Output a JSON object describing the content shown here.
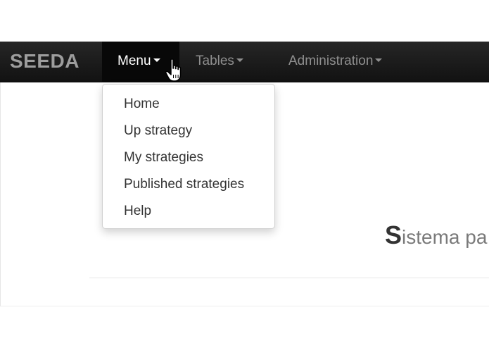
{
  "navbar": {
    "brand": "SEEDA",
    "items": [
      {
        "label": "Menu",
        "active": true
      },
      {
        "label": "Tables",
        "active": false
      },
      {
        "label": "Administration",
        "active": false
      }
    ]
  },
  "dropdown": {
    "items": [
      {
        "label": "Home"
      },
      {
        "label": "Up strategy"
      },
      {
        "label": "My strategies"
      },
      {
        "label": "Published strategies"
      },
      {
        "label": "Help"
      }
    ]
  },
  "main": {
    "headline_first_letter": "S",
    "headline_rest": "istema pa"
  },
  "icons": {
    "caret": "caret-down-icon",
    "cursor": "hand-pointer-icon"
  },
  "colors": {
    "navbar_bg": "#1b1b1b",
    "active_tab_bg": "#080808",
    "nav_text": "#8f8f8f",
    "active_text": "#ffffff",
    "dropdown_text": "#333333"
  }
}
